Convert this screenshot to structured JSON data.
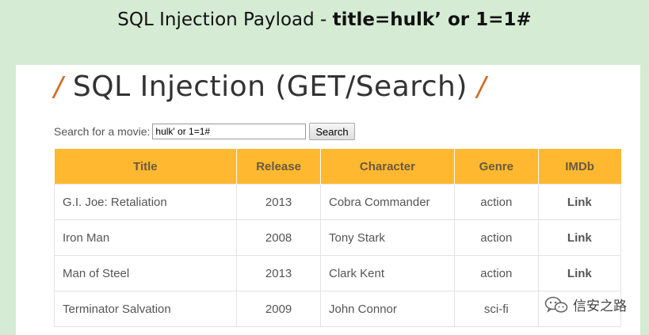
{
  "slide": {
    "title_prefix": "SQL Injection Payload - ",
    "title_payload": "title=hulk’ or 1=1#"
  },
  "app": {
    "heading_slash_left": "/",
    "heading_text": "SQL Injection (GET/Search)",
    "heading_slash_right": "/",
    "search": {
      "label": "Search for a movie:",
      "value": "hulk' or 1=1#",
      "button_label": "Search"
    },
    "table": {
      "headers": [
        "Title",
        "Release",
        "Character",
        "Genre",
        "IMDb"
      ],
      "rows": [
        {
          "title": "G.I. Joe: Retaliation",
          "release": "2013",
          "character": "Cobra Commander",
          "genre": "action",
          "imdb": "Link"
        },
        {
          "title": "Iron Man",
          "release": "2008",
          "character": "Tony Stark",
          "genre": "action",
          "imdb": "Link"
        },
        {
          "title": "Man of Steel",
          "release": "2013",
          "character": "Clark Kent",
          "genre": "action",
          "imdb": "Link"
        },
        {
          "title": "Terminator Salvation",
          "release": "2009",
          "character": "John Connor",
          "genre": "sci-fi",
          "imdb": ""
        }
      ]
    }
  },
  "watermark": {
    "icon": "wechat-icon",
    "text": "信安之路"
  },
  "colors": {
    "background": "#d5ebd4",
    "table_header": "#ffb82f",
    "slash_accent": "#d2691e"
  }
}
